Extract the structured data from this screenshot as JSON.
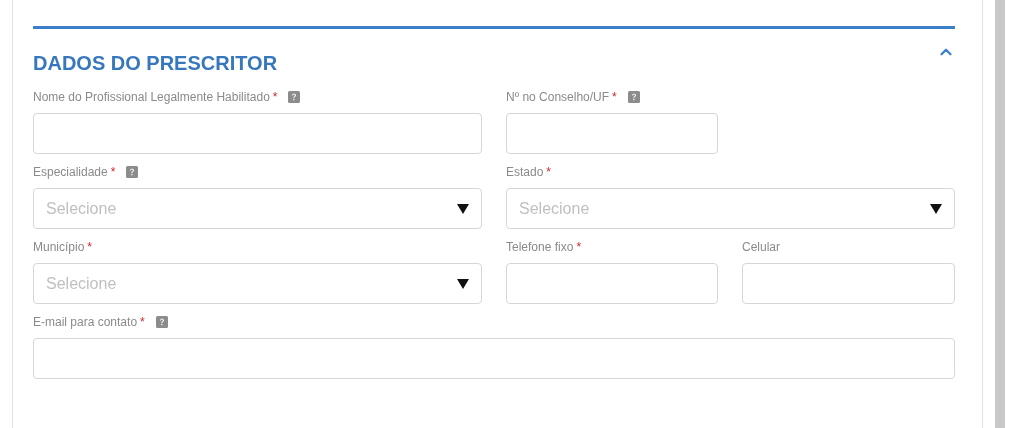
{
  "section": {
    "title": "DADOS DO PRESCRITOR",
    "expanded": true
  },
  "rows": [
    {
      "fields": [
        {
          "kind": "text",
          "label": "Nome do Profissional Legalmente Habilitado",
          "mark": "*",
          "help": true
        },
        {
          "kind": "text",
          "label": "Nº no Conselho/UF",
          "mark": "*",
          "help": true
        }
      ]
    },
    {
      "fields": [
        {
          "kind": "select",
          "label": "Especialidade",
          "mark": "*",
          "help": true,
          "placeholder": "Selecione"
        },
        {
          "kind": "select",
          "label": "Estado",
          "mark": "*",
          "help": false,
          "placeholder": "Selecione"
        }
      ]
    },
    {
      "fields": [
        {
          "kind": "select",
          "label": "Município",
          "mark": "*",
          "help": false,
          "placeholder": "Selecione"
        },
        {
          "kind": "text",
          "label": "Telefone fixo",
          "mark": "*",
          "help": false
        },
        {
          "kind": "text",
          "label": "Celular",
          "help": false
        }
      ]
    },
    {
      "fields": [
        {
          "kind": "text",
          "label": "E-mail para contato",
          "mark": "*",
          "help": true
        }
      ]
    }
  ]
}
